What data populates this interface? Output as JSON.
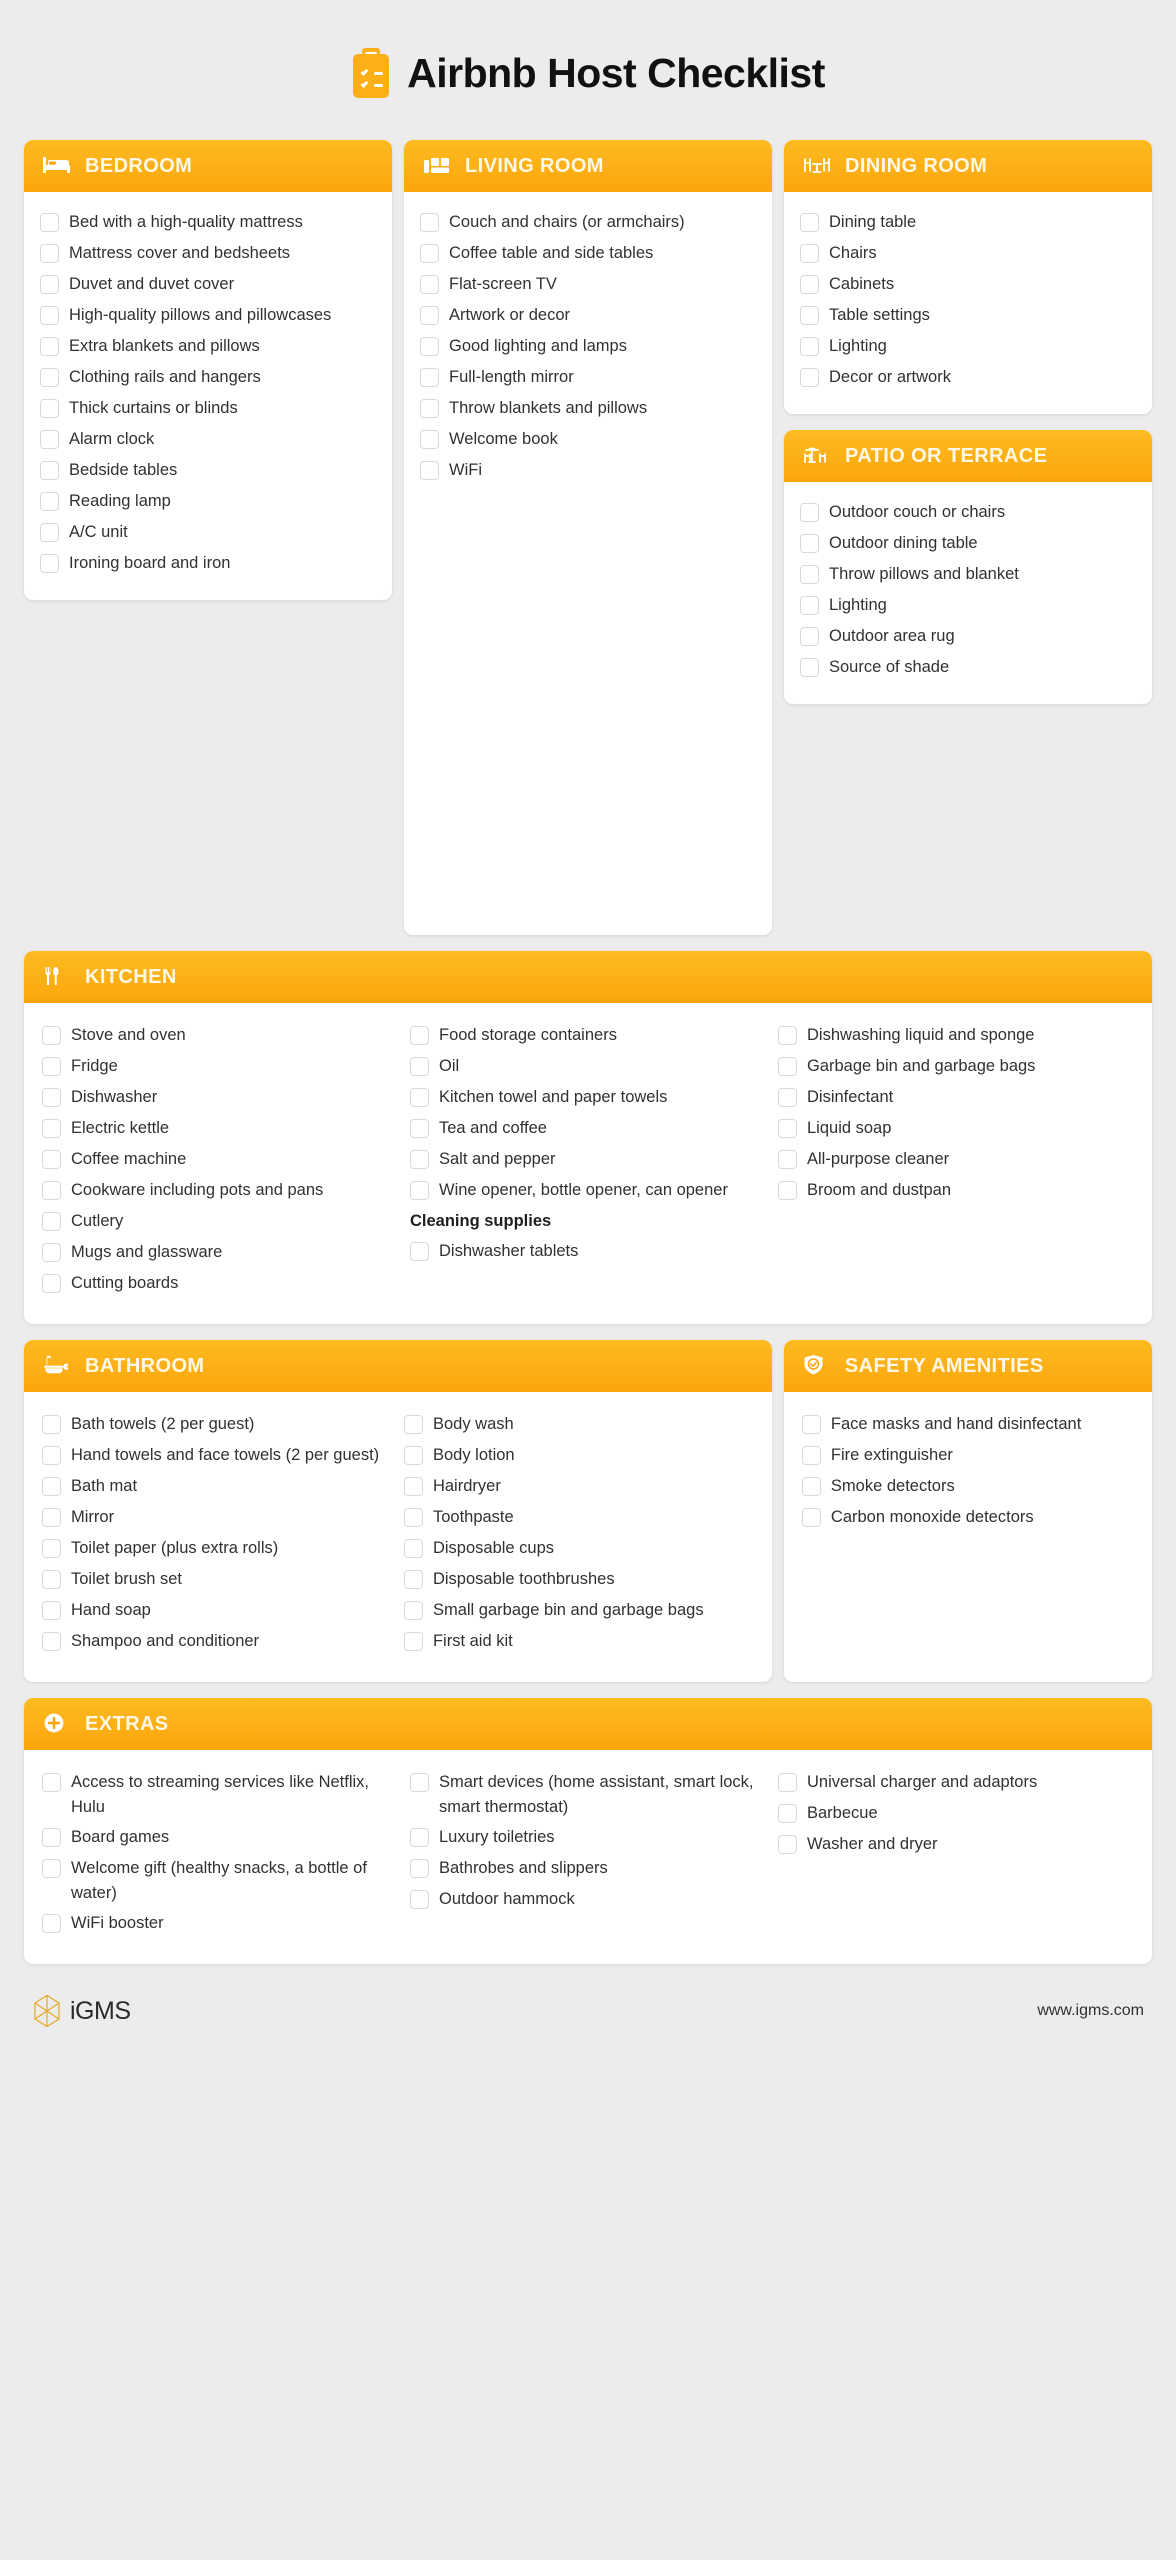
{
  "header": {
    "title": "Airbnb Host Checklist",
    "icon": "clipboard-checklist-icon"
  },
  "theme": {
    "accent": "#FBA60B",
    "accent_light": "#FDBB22",
    "header_text": "#FFF8E6",
    "page_bg": "#ececec",
    "card_bg": "#ffffff",
    "text": "#2f3133",
    "checkbox_border": "#d9d9d9"
  },
  "sections": [
    {
      "id": "bedroom",
      "title": "BEDROOM",
      "icon": "bed-icon",
      "columns": [
        {
          "items": [
            "Bed with a high-quality mattress",
            "Mattress cover and bedsheets",
            "Duvet and duvet cover",
            "High-quality pillows and pillowcases",
            "Extra blankets and pillows",
            "Clothing rails and hangers",
            "Thick curtains or blinds",
            "Alarm clock",
            "Bedside tables",
            "Reading lamp",
            "A/C unit",
            "Ironing board and iron"
          ]
        }
      ]
    },
    {
      "id": "living-room",
      "title": "LIVING ROOM",
      "icon": "couch-icon",
      "columns": [
        {
          "items": [
            "Couch and chairs (or armchairs)",
            "Coffee table and side tables",
            "Flat-screen TV",
            "Artwork or decor",
            "Good lighting and lamps",
            "Full-length mirror",
            "Throw blankets and pillows",
            "Welcome book",
            "WiFi"
          ]
        }
      ]
    },
    {
      "id": "dining-room",
      "title": "DINING ROOM",
      "icon": "dining-table-icon",
      "columns": [
        {
          "items": [
            "Dining table",
            "Chairs",
            "Cabinets",
            "Table settings",
            "Lighting",
            "Decor or artwork"
          ]
        }
      ]
    },
    {
      "id": "patio-or-terrace",
      "title": "PATIO OR TERRACE",
      "icon": "patio-umbrella-icon",
      "columns": [
        {
          "items": [
            "Outdoor couch or chairs",
            "Outdoor dining table",
            "Throw pillows and blanket",
            "Lighting",
            "Outdoor area rug",
            "Source of shade"
          ]
        }
      ]
    },
    {
      "id": "kitchen",
      "title": "KITCHEN",
      "icon": "fork-knife-icon",
      "columns": [
        {
          "items": [
            "Stove and oven",
            "Fridge",
            "Dishwasher",
            "Electric kettle",
            "Coffee machine",
            "Cookware including pots and pans",
            "Cutlery",
            "Mugs and glassware",
            "Cutting boards"
          ]
        },
        {
          "items": [
            "Food storage containers",
            "Oil",
            "Kitchen towel and paper towels",
            "Tea and coffee",
            "Salt and pepper",
            "Wine opener, bottle opener, can opener"
          ],
          "subheading": "Cleaning supplies",
          "items_after": [
            "Dishwasher tablets"
          ]
        },
        {
          "items": [
            "Dishwashing liquid and sponge",
            "Garbage bin and garbage bags",
            "Disinfectant",
            "Liquid soap",
            "All-purpose cleaner",
            "Broom and dustpan"
          ]
        }
      ]
    },
    {
      "id": "bathroom",
      "title": "BATHROOM",
      "icon": "bathtub-icon",
      "columns": [
        {
          "items": [
            "Bath towels (2 per guest)",
            "Hand towels and face towels (2 per guest)",
            "Bath mat",
            "Mirror",
            "Toilet paper (plus extra rolls)",
            "Toilet brush set",
            "Hand soap",
            "Shampoo and conditioner"
          ]
        },
        {
          "items": [
            "Body wash",
            "Body lotion",
            "Hairdryer",
            "Toothpaste",
            "Disposable cups",
            "Disposable toothbrushes",
            "Small garbage bin and garbage bags",
            "First aid kit"
          ]
        }
      ]
    },
    {
      "id": "safety-amenities",
      "title": "SAFETY AMENITIES",
      "icon": "shield-check-icon",
      "columns": [
        {
          "items": [
            "Face masks and hand disinfectant",
            "Fire extinguisher",
            "Smoke detectors",
            "Carbon monoxide detectors"
          ]
        }
      ]
    },
    {
      "id": "extras",
      "title": "EXTRAS",
      "icon": "plus-circle-icon",
      "columns": [
        {
          "items": [
            "Access to streaming services like Netflix, Hulu",
            "Board games",
            "Welcome gift (healthy snacks, a bottle of water)",
            "WiFi booster"
          ]
        },
        {
          "items": [
            "Smart devices (home assistant, smart lock, smart thermostat)",
            "Luxury toiletries",
            "Bathrobes and slippers",
            "Outdoor hammock"
          ]
        },
        {
          "items": [
            "Universal charger and adaptors",
            "Barbecue",
            "Washer and dryer"
          ]
        }
      ]
    }
  ],
  "footer": {
    "brand_name": "iGMS",
    "brand_icon": "igms-logo-icon",
    "url": "www.igms.com"
  }
}
